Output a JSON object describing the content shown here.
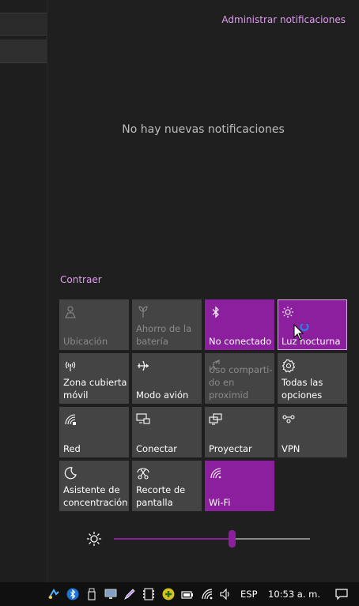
{
  "action_center": {
    "manage_notifications": "Administrar notificaciones",
    "empty_message": "No hay nuevas notificaciones",
    "collapse": "Contraer"
  },
  "tiles": [
    {
      "label": "Ubicación",
      "icon": "location-icon",
      "state": "disabled"
    },
    {
      "label": "Ahorro de la\nbatería",
      "icon": "battery-saver-icon",
      "state": "disabled"
    },
    {
      "label": "No conectado",
      "icon": "bluetooth-icon",
      "state": "on"
    },
    {
      "label": "Luz nocturna",
      "icon": "night-light-icon",
      "state": "on"
    },
    {
      "label": "Zona cubierta\nmóvil",
      "icon": "mobile-hotspot-icon",
      "state": "off"
    },
    {
      "label": "Modo avión",
      "icon": "airplane-icon",
      "state": "off"
    },
    {
      "label": "Uso comparti-\ndo en proximid",
      "icon": "nearby-sharing-icon",
      "state": "disabled"
    },
    {
      "label": "Todas las\nopciones",
      "icon": "settings-icon",
      "state": "off"
    },
    {
      "label": "Red",
      "icon": "network-icon",
      "state": "off"
    },
    {
      "label": "Conectar",
      "icon": "connect-icon",
      "state": "off"
    },
    {
      "label": "Proyectar",
      "icon": "project-icon",
      "state": "off"
    },
    {
      "label": "VPN",
      "icon": "vpn-icon",
      "state": "off"
    },
    {
      "label": "Asistente de\nconcentración",
      "icon": "focus-assist-icon",
      "state": "off"
    },
    {
      "label": "Recorte de\npantalla",
      "icon": "screen-snip-icon",
      "state": "off"
    },
    {
      "label": "Wi-Fi",
      "icon": "wifi-icon",
      "state": "on"
    }
  ],
  "brightness": {
    "icon": "brightness-icon",
    "level_percent": 60
  },
  "taskbar": {
    "language": "ESP",
    "clock": "10:53 a. m.",
    "tray_icons": [
      "app-icon",
      "bluetooth-icon",
      "usb-icon",
      "display-icon",
      "pen-icon",
      "video-icon",
      "plus-app-icon",
      "battery-icon",
      "wifi-icon",
      "volume-icon"
    ]
  },
  "colors": {
    "accent": "#8b1f9e",
    "link": "#e09cf0",
    "tile_off": "#444444",
    "background": "#1f1f1f"
  }
}
